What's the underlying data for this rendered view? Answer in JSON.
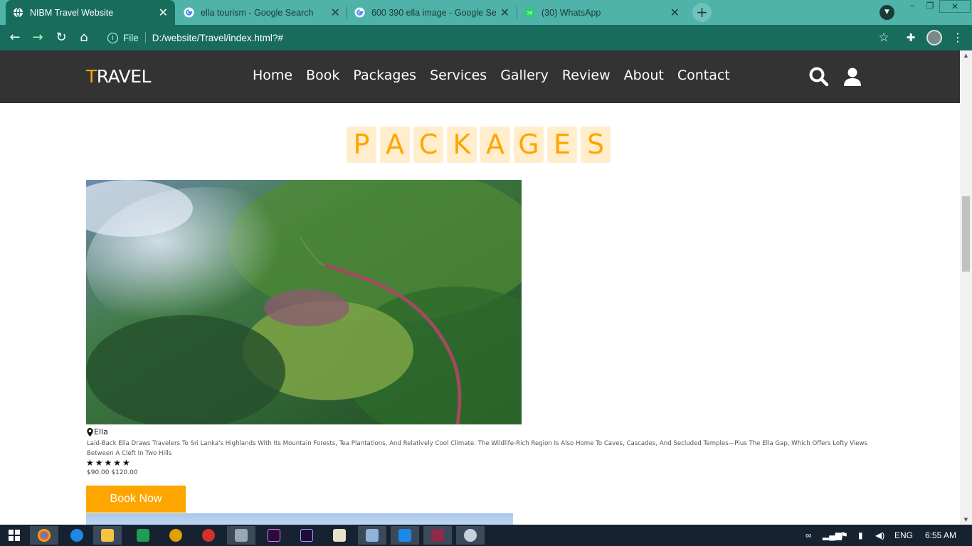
{
  "browser": {
    "tabs": [
      {
        "title": "NIBM Travel Website",
        "active": true,
        "icon": "globe-icon"
      },
      {
        "title": "ella tourism - Google Search",
        "active": false,
        "icon": "google-icon"
      },
      {
        "title": "600 390 ella image - Google Search",
        "active": false,
        "icon": "google-icon"
      },
      {
        "title": "(30) WhatsApp",
        "active": false,
        "icon": "whatsapp-icon"
      }
    ],
    "close_glyph": "✕",
    "new_tab_glyph": "+",
    "address": {
      "scheme_label": "File",
      "url": "D:/website/Travel/index.html?#"
    },
    "window_controls": [
      "−",
      "❐",
      "✕"
    ]
  },
  "site": {
    "logo_highlight": "T",
    "logo_rest": "RAVEL",
    "nav": [
      "Home",
      "Book",
      "Packages",
      "Services",
      "Gallery",
      "Review",
      "About",
      "Contact"
    ],
    "heading_letters": [
      "P",
      "A",
      "C",
      "K",
      "A",
      "G",
      "E",
      "S"
    ],
    "package": {
      "location": "Ella",
      "description": "Laid-Back Ella Draws Travelers To Sri Lanka's Highlands With Its Mountain Forests, Tea Plantations, And Relatively Cool Climate. The Wildlife-Rich Region Is Also Home To Caves, Cascades, And Secluded Temples—Plus The Ella Gap, Which Offers Lofty Views Between A Cleft In Two Hills",
      "rating": 5,
      "stars": "★★★★★",
      "price": "$90.00",
      "old_price": "$120.00",
      "button_label": "Book Now"
    },
    "accent_color": "#ffa500",
    "header_color": "#333333"
  },
  "taskbar": {
    "language": "ENG",
    "time": "6:55 AM"
  }
}
